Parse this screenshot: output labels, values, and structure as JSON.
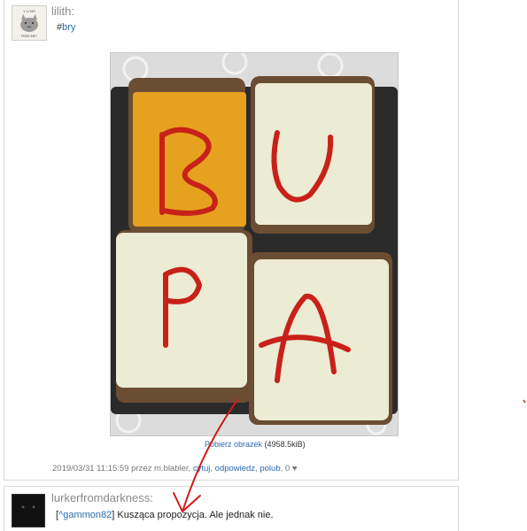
{
  "post": {
    "username": "lilith:",
    "tag_prefix": "#",
    "tag": "bry",
    "avatar_caption_top": "Y U NO",
    "avatar_caption_bottom": "FEED ME?",
    "download_link": "Pobierz obrazek",
    "download_size": "(4958.5kiB)",
    "timestamp": "2019/03/31 11:15:59",
    "by_label": "przez",
    "author": "m.blabler",
    "edit_label": "cytuj",
    "reply_label": "odpowiedz",
    "like_label": "polub",
    "like_count": "0",
    "heart": "♥"
  },
  "reply": {
    "username": "lurkerfromdarkness:",
    "mention": "^gammon82",
    "text": "Kusząca propozycja. Ale jednak nie."
  },
  "colors": {
    "link": "#2a6cb0",
    "annotation": "#d11a1a",
    "ketchup": "#c8211a",
    "cheddar": "#e6a21e",
    "white_cheese": "#ecebd4"
  }
}
